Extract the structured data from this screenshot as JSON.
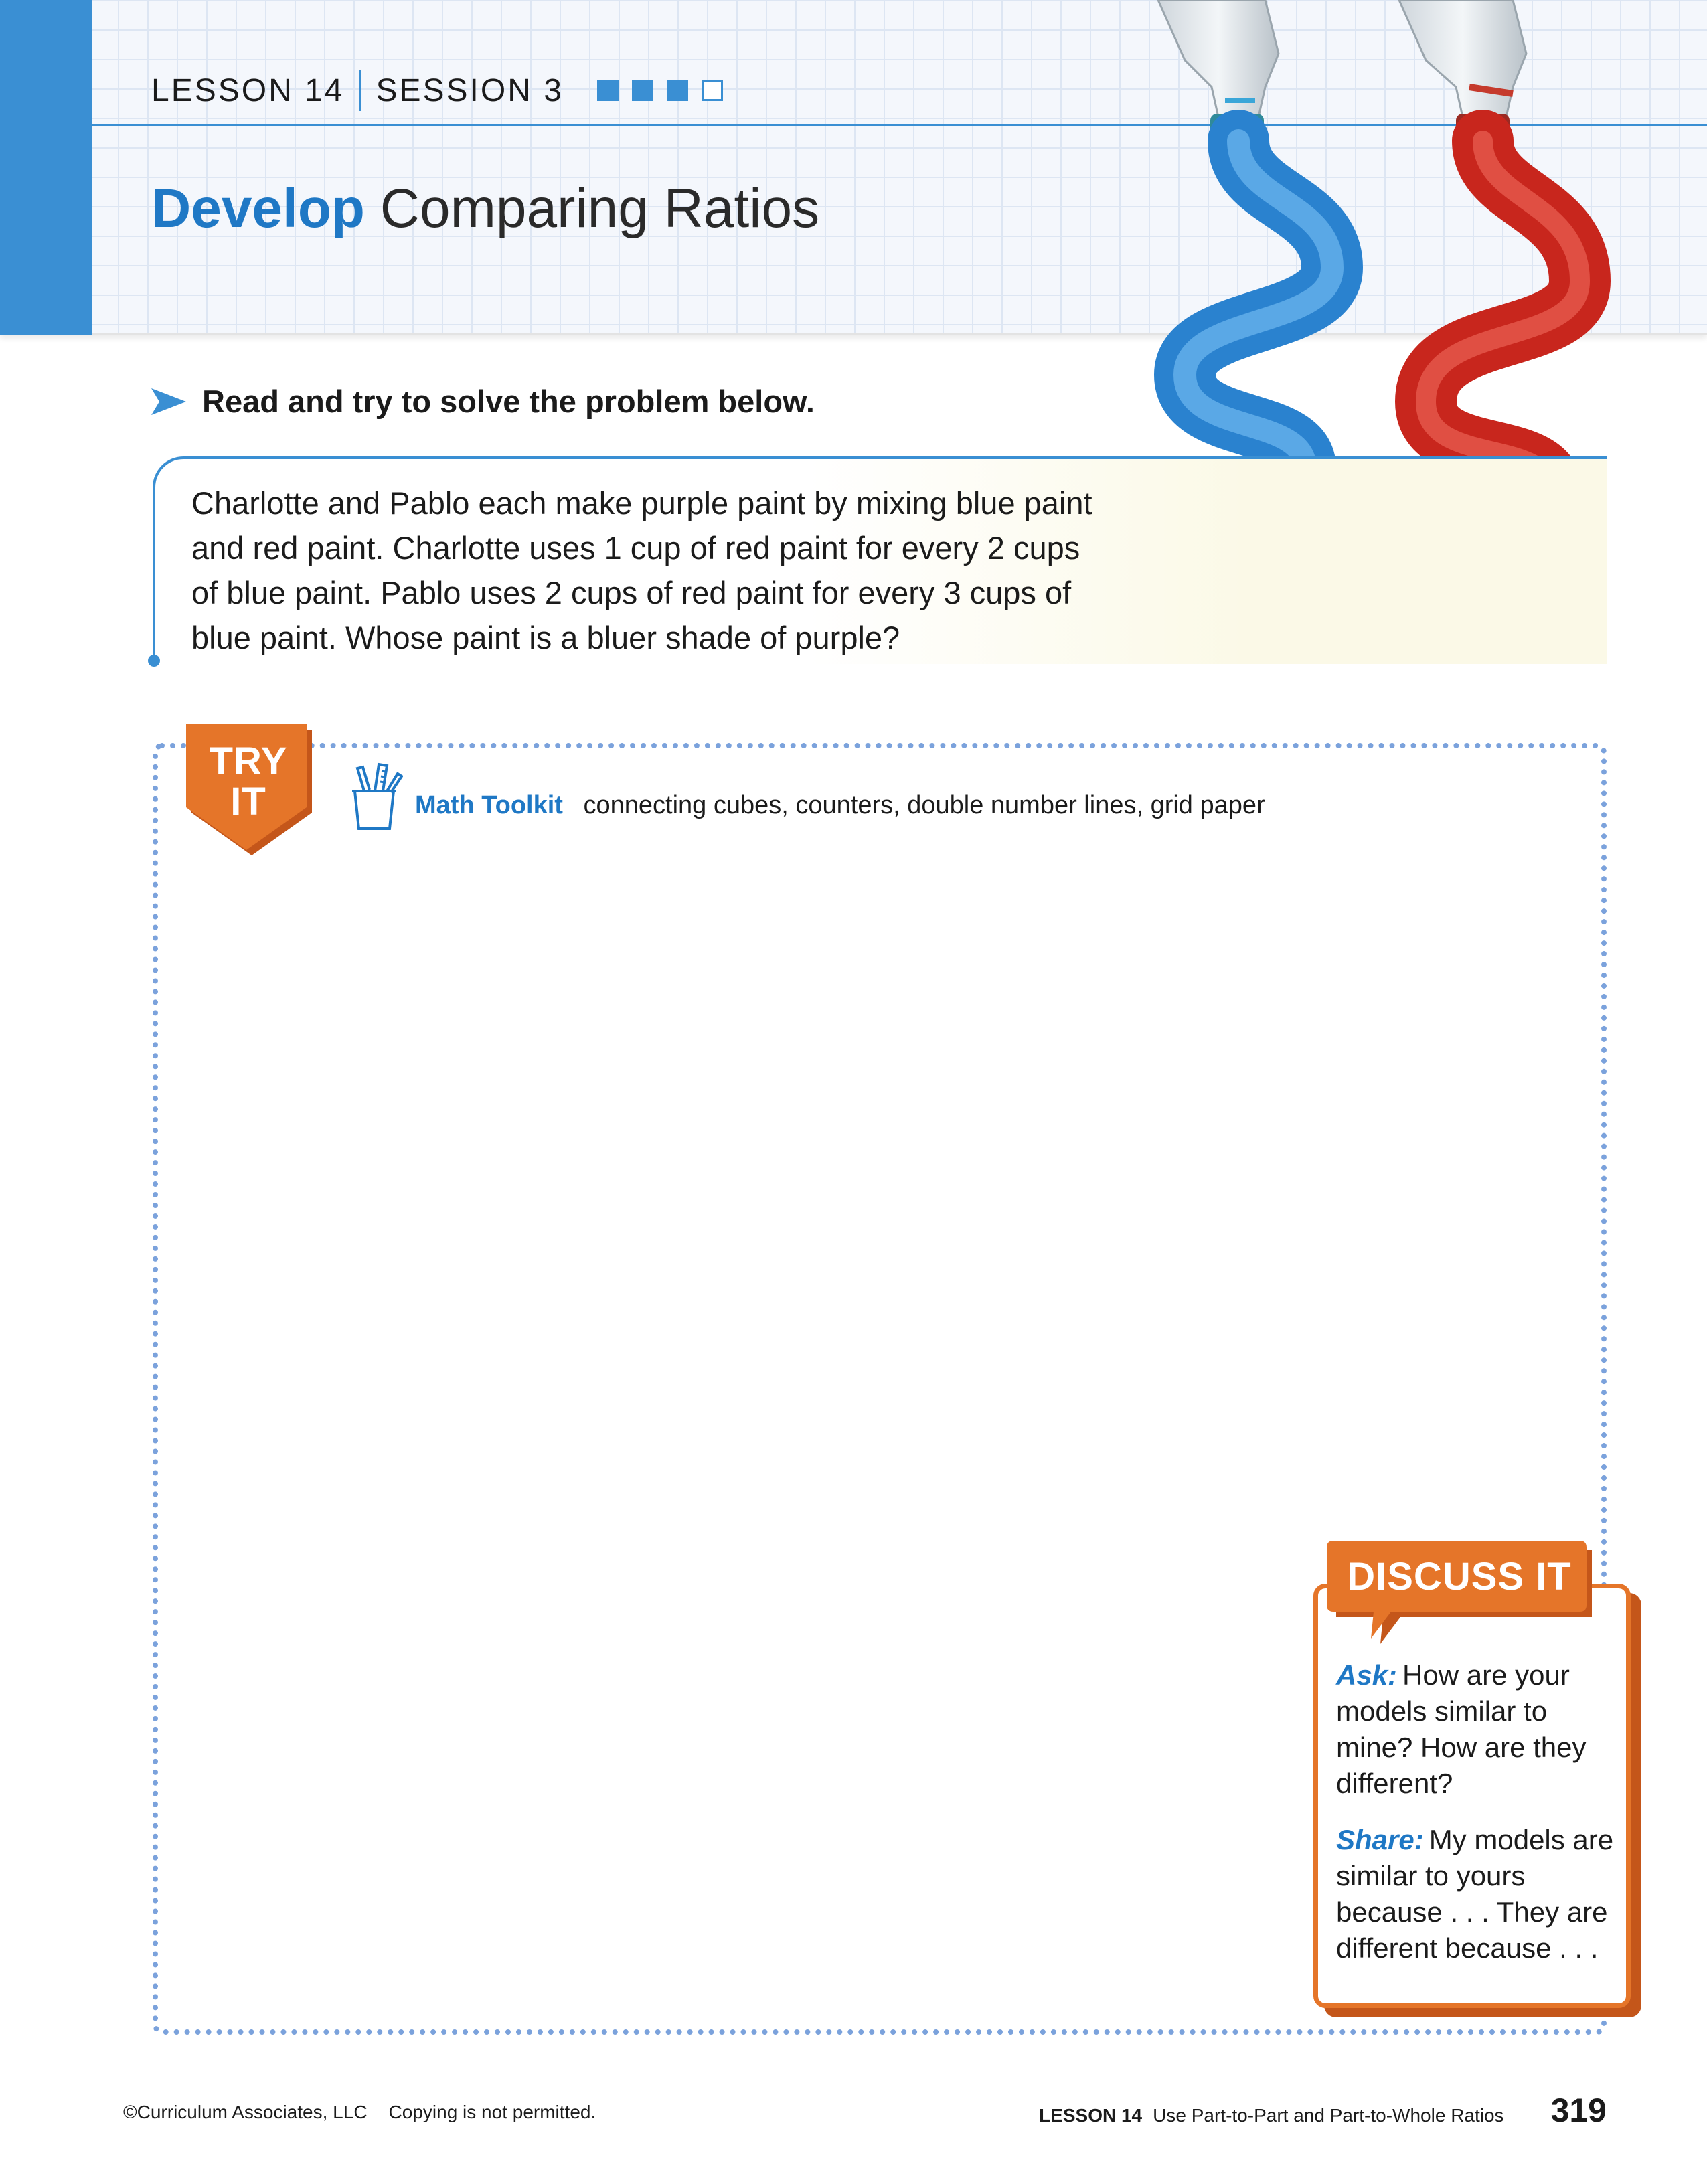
{
  "header": {
    "lesson": "LESSON 14",
    "session": "SESSION 3",
    "progress": [
      true,
      true,
      true,
      false
    ],
    "title_strong": "Develop",
    "title_rest": "Comparing Ratios",
    "colors": {
      "accent": "#3a8fd3",
      "title": "#1f78c5"
    }
  },
  "instruction": {
    "icon": "arrow-right-icon",
    "text": "Read and try to solve the problem below."
  },
  "problem": {
    "lines": [
      "Charlotte and Pablo each make purple paint by mixing blue paint",
      "and red paint. Charlotte uses 1 cup of red paint for every 2 cups",
      "of blue paint. Pablo uses 2 cups of red paint for every 3 cups of",
      "blue paint. Whose paint is a bluer shade of purple?"
    ]
  },
  "try_it": {
    "badge_line1": "TRY",
    "badge_line2": "IT",
    "toolkit_icon": "pencil-cup-icon",
    "toolkit_label": "Math Toolkit",
    "toolkit_items": "connecting cubes, counters, double number lines, grid paper",
    "colors": {
      "badge": "#e57529",
      "border": "#7ba2dc"
    }
  },
  "discuss": {
    "title": "DISCUSS IT",
    "ask_label": "Ask:",
    "ask_text": "How are your models similar to mine? How are they different?",
    "share_label": "Share:",
    "share_text": "My models are similar to yours because . . . They are different because . . ."
  },
  "footer": {
    "copyright": "©Curriculum Associates, LLC",
    "notice": "Copying is not permitted.",
    "lesson": "LESSON 14",
    "lesson_title": "Use Part-to-Part and Part-to-Whole Ratios",
    "page": "319"
  }
}
